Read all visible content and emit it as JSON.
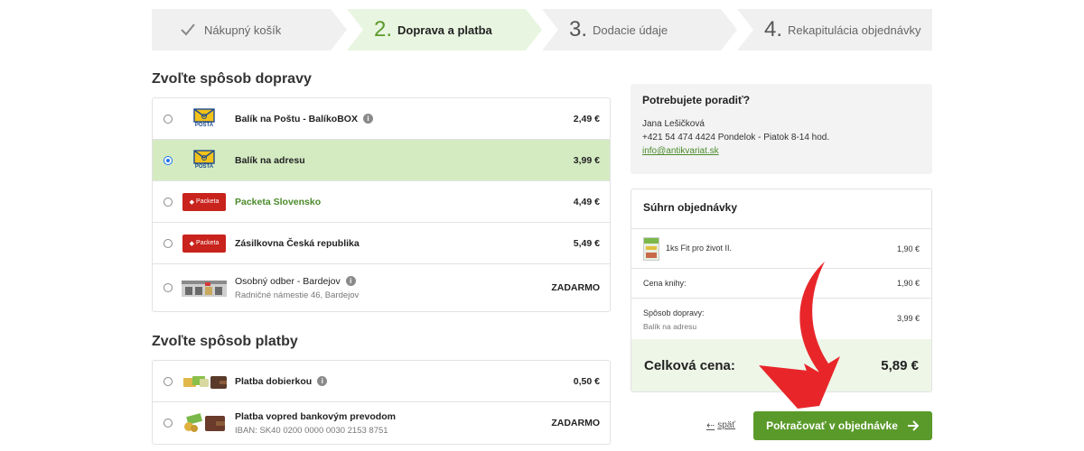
{
  "steps": [
    {
      "number": "",
      "label": "Nákupný košík",
      "icon": "check-icon"
    },
    {
      "number": "2.",
      "label": "Doprava a platba"
    },
    {
      "number": "3.",
      "label": "Dodacie údaje"
    },
    {
      "number": "4.",
      "label": "Rekapitulácia objednávky"
    }
  ],
  "shipping": {
    "heading": "Zvoľte spôsob dopravy",
    "options": [
      {
        "name": "Balík na Poštu - BalíkoBOX",
        "price": "2,49 €",
        "logo": "slovenska-posta",
        "info": true
      },
      {
        "name": "Balík na adresu",
        "price": "3,99 €",
        "logo": "slovenska-posta",
        "selected": true
      },
      {
        "name": "Packeta Slovensko",
        "price": "4,49 €",
        "logo": "packeta"
      },
      {
        "name": "Zásilkovna Česká republika",
        "price": "5,49 €",
        "logo": "packeta"
      },
      {
        "name": "Osobný odber - Bardejov",
        "sub": "Radničné námestie 46, Bardejov",
        "price": "ZADARMO",
        "logo": "storefront",
        "info": true
      }
    ]
  },
  "payment": {
    "heading": "Zvoľte spôsob platby",
    "options": [
      {
        "name": "Platba dobierkou",
        "price": "0,50 €",
        "logo": "cards-wallet",
        "info": true
      },
      {
        "name": "Platba vopred bankovým prevodom",
        "sub": "IBAN: SK40 0200 0000 0030 2153 8751",
        "price": "ZADARMO",
        "logo": "money-wallet"
      }
    ]
  },
  "logos": {
    "posta_top": "Slovenská",
    "posta_bottom": "POŠTA",
    "packeta": "Packeta"
  },
  "help": {
    "title": "Potrebujete poradiť?",
    "name": "Jana Lešičková",
    "phone": "+421 54 474 4424",
    "hours": "Pondelok - Piatok 8-14 hod.",
    "email": "info@antikvariat.sk"
  },
  "summary": {
    "title": "Súhrn objednávky",
    "item": {
      "label": "1ks Fit pro život II.",
      "price": "1,90 €"
    },
    "books": {
      "label": "Cena knihy:",
      "price": "1,90 €"
    },
    "shipping": {
      "label": "Spôsob dopravy:",
      "sub": "Balík na adresu",
      "price": "3,99 €"
    },
    "total": {
      "label": "Celková cena:",
      "price": "5,89 €"
    }
  },
  "actions": {
    "back": "späť",
    "continue": "Pokračovať v objednávke"
  },
  "colors": {
    "accent": "#5a9a2a",
    "selected_bg": "#d4ebc2",
    "arrow": "#e8262a",
    "packeta": "#c8231c"
  }
}
